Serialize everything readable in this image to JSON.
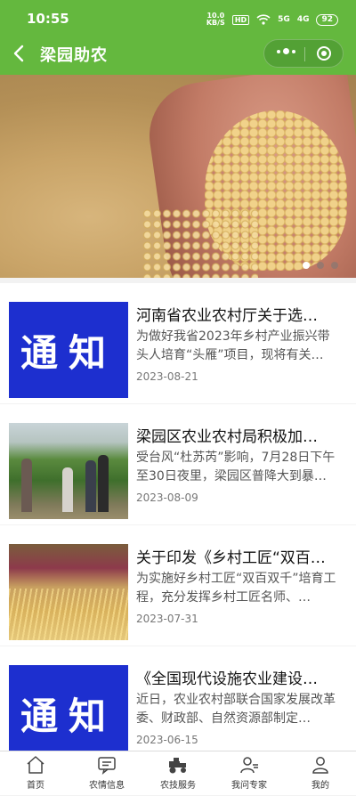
{
  "status_bar": {
    "time": "10:55",
    "net_speed_top": "10.0",
    "net_speed_bottom": "KB/S",
    "hd": "HD",
    "signal1": "5G",
    "signal2": "4G",
    "battery": "92"
  },
  "nav": {
    "title": "梁园助农"
  },
  "banner": {
    "slides": 3,
    "active_index": 0
  },
  "news": [
    {
      "title": "河南省农业农村厅关于选…",
      "summary": "为做好我省2023年乡村产业振兴带头人培育“头雁”项目，现将有关…",
      "date": "2023-08-21",
      "thumb": "notice",
      "thumb_text": "通知"
    },
    {
      "title": "梁园区农业农村局积极加…",
      "summary": "受台风“杜苏芮”影响，7月28日下午至30日夜里，梁园区普降大到暴…",
      "date": "2023-08-09",
      "thumb": "photo-field"
    },
    {
      "title": "关于印发《乡村工匠“双百…",
      "summary": "为实施好乡村工匠“双百双千”培育工程，充分发挥乡村工匠名师、…",
      "date": "2023-07-31",
      "thumb": "photo-craft"
    },
    {
      "title": "《全国现代设施农业建设…",
      "summary": "近日，农业农村部联合国家发展改革委、财政部、自然资源部制定…",
      "date": "2023-06-15",
      "thumb": "notice",
      "thumb_text": "通知"
    }
  ],
  "tabbar": {
    "items": [
      {
        "label": "首页",
        "icon": "home-icon"
      },
      {
        "label": "农情信息",
        "icon": "message-icon"
      },
      {
        "label": "农技服务",
        "icon": "tractor-icon"
      },
      {
        "label": "我问专家",
        "icon": "expert-icon"
      },
      {
        "label": "我的",
        "icon": "user-icon"
      }
    ]
  },
  "colors": {
    "header": "#64b83e",
    "notice_blue": "#1d2fcf"
  }
}
